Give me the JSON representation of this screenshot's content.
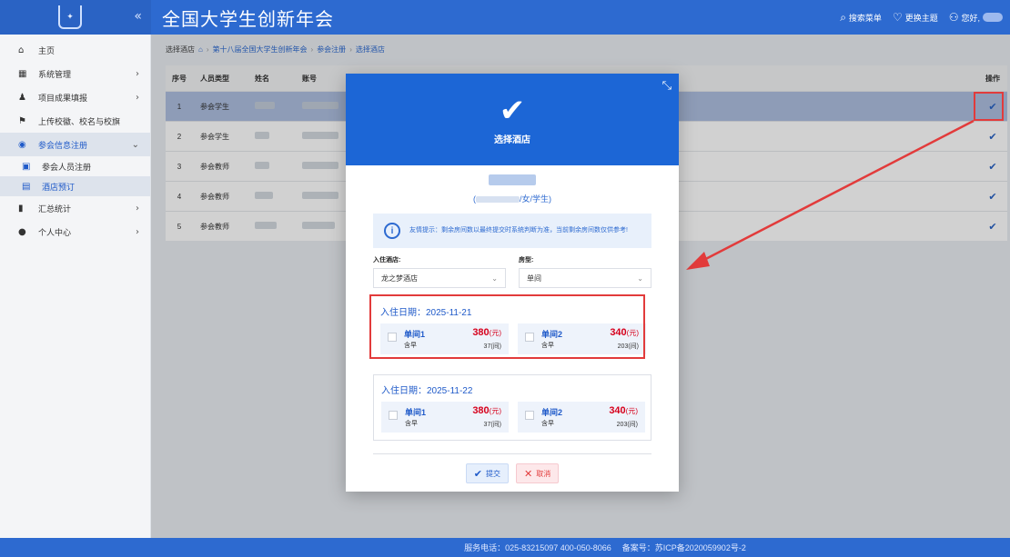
{
  "header": {
    "app_title": "全国大学生创新年会",
    "collapse_icon": "«",
    "actions": [
      {
        "icon": "search-icon",
        "label": "搜索菜单"
      },
      {
        "icon": "heart-icon",
        "label": "更换主题"
      },
      {
        "icon": "user-icon",
        "label": "您好,"
      }
    ]
  },
  "sidebar": {
    "items": [
      {
        "label": "主页",
        "icon": "home-icon"
      },
      {
        "label": "系统管理",
        "icon": "grid-icon"
      },
      {
        "label": "项目成果填报",
        "icon": "user-add-icon"
      },
      {
        "label": "上传校徽、校名与校旗",
        "icon": "flag-icon"
      },
      {
        "label": "参会信息注册",
        "icon": "globe-icon"
      },
      {
        "label": "参会人员注册",
        "icon": "building-icon"
      },
      {
        "label": "酒店预订",
        "icon": "hotel-icon"
      },
      {
        "label": "汇总统计",
        "icon": "bar-chart-icon"
      },
      {
        "label": "个人中心",
        "icon": "person-icon"
      }
    ]
  },
  "breadcrumb": {
    "current": "选择酒店",
    "path": [
      "第十八届全国大学生创新年会",
      "参会注册",
      "选择酒店"
    ]
  },
  "table": {
    "headers": {
      "no": "序号",
      "type": "人员类型",
      "name": "姓名",
      "account": "账号",
      "op": "操作"
    },
    "rows": [
      {
        "no": "1",
        "type": "参会学生"
      },
      {
        "no": "2",
        "type": "参会学生"
      },
      {
        "no": "3",
        "type": "参会教师"
      },
      {
        "no": "4",
        "type": "参会教师"
      },
      {
        "no": "5",
        "type": "参会教师"
      }
    ]
  },
  "modal": {
    "title": "选择酒店",
    "person_info_suffix": "/女/学生)",
    "person_info_prefix": "(",
    "tip": "友情提示：剩余房间数以最终提交时系统判断为准，当前剩余房间数仅供参考!",
    "hotel_label": "入住酒店:",
    "hotel_value": "龙之梦酒店",
    "room_type_label": "房型:",
    "room_type_value": "单间",
    "dates": [
      {
        "label": "入住日期：2025-11-21",
        "rooms": [
          {
            "name": "单间1",
            "meal": "含早",
            "price": "380",
            "unit": "(元)",
            "left": "37(间)"
          },
          {
            "name": "单间2",
            "meal": "含早",
            "price": "340",
            "unit": "(元)",
            "left": "203(间)"
          }
        ]
      },
      {
        "label": "入住日期：2025-11-22",
        "rooms": [
          {
            "name": "单间1",
            "meal": "含早",
            "price": "380",
            "unit": "(元)",
            "left": "37(间)"
          },
          {
            "name": "单间2",
            "meal": "含早",
            "price": "340",
            "unit": "(元)",
            "left": "203(间)"
          }
        ]
      }
    ],
    "submit_label": "提交",
    "cancel_label": "取消"
  },
  "footer": {
    "phone": "服务电话：025-83215097  400-050-8066",
    "icp": "备案号：苏ICP备2020059902号-2"
  },
  "colors": {
    "brand": "#2d6ad0",
    "modal_header": "#1c66d6",
    "price": "#d6001c",
    "highlight": "#e23b3b"
  }
}
